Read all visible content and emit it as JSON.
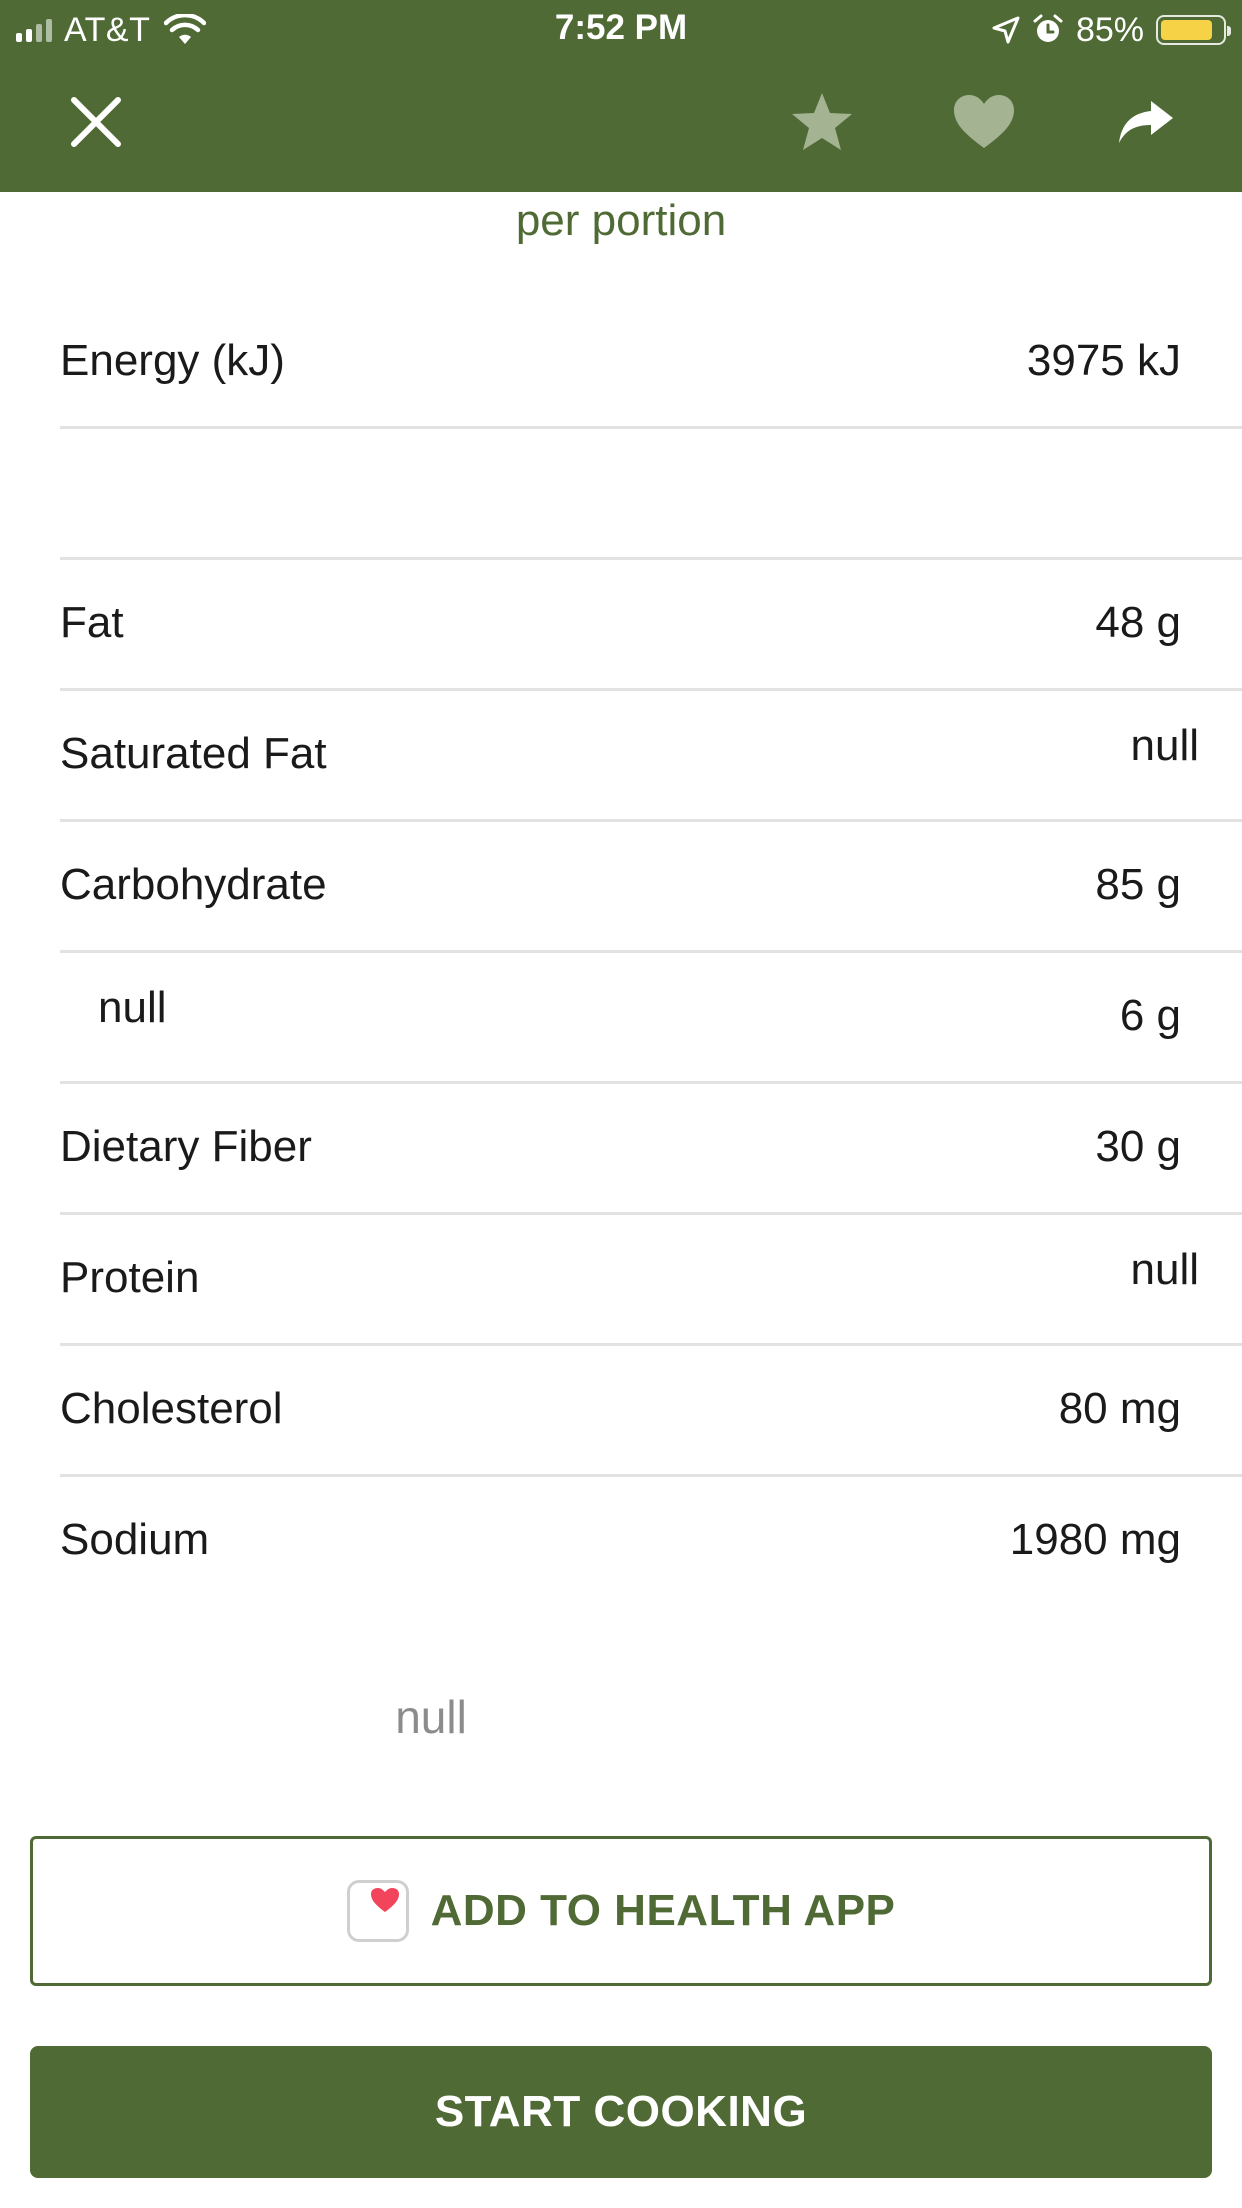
{
  "status_bar": {
    "carrier": "AT&T",
    "time": "7:52 PM",
    "battery_percent": "85%",
    "battery_level": 0.85
  },
  "nav": {
    "close_icon": "close-icon",
    "star_icon": "star-icon",
    "heart_icon": "heart-icon",
    "share_icon": "share-arrow-icon"
  },
  "nutrition": {
    "subtitle": "per portion",
    "rows": [
      {
        "label": "Energy (kJ)",
        "value": "3975 kJ"
      },
      {
        "label": "",
        "value": ""
      },
      {
        "label": "Fat",
        "value": "48 g"
      },
      {
        "label": "Saturated Fat",
        "value": "null"
      },
      {
        "label": "Carbohydrate",
        "value": "85 g"
      },
      {
        "label": "null",
        "value": "6 g"
      },
      {
        "label": "Dietary Fiber",
        "value": "30 g"
      },
      {
        "label": "Protein",
        "value": "null"
      },
      {
        "label": "Cholesterol",
        "value": "80 mg"
      },
      {
        "label": "Sodium",
        "value": "1980 mg"
      }
    ],
    "disclaimer": "null"
  },
  "actions": {
    "health_label": "ADD TO HEALTH APP",
    "start_label": "START COOKING"
  },
  "colors": {
    "brand_green": "#4f6a35",
    "battery_yellow": "#f6d246",
    "health_heart": "#f2455b",
    "icon_muted": "#a4b493"
  }
}
